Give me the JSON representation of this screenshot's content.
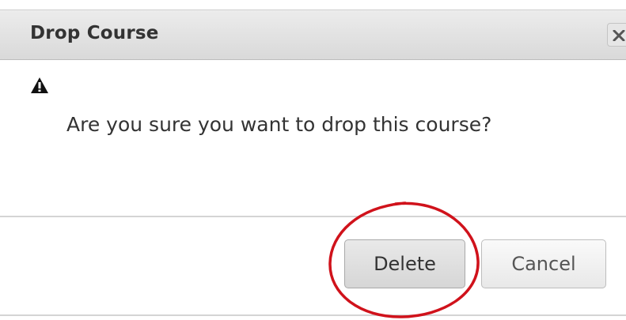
{
  "dialog": {
    "title": "Drop Course",
    "close_icon": "close-icon",
    "warning_icon": "warning-icon",
    "message": "Are you sure you want to drop this course?"
  },
  "buttons": {
    "delete_label": "Delete",
    "cancel_label": "Cancel"
  },
  "annotation": {
    "type": "highlight-circle",
    "target": "delete-button",
    "color": "#d0121b"
  },
  "colors": {
    "title_text": "#333333",
    "titlebar_background": "#dedede",
    "body_background": "#ffffff",
    "divider": "#d4d4d4"
  }
}
